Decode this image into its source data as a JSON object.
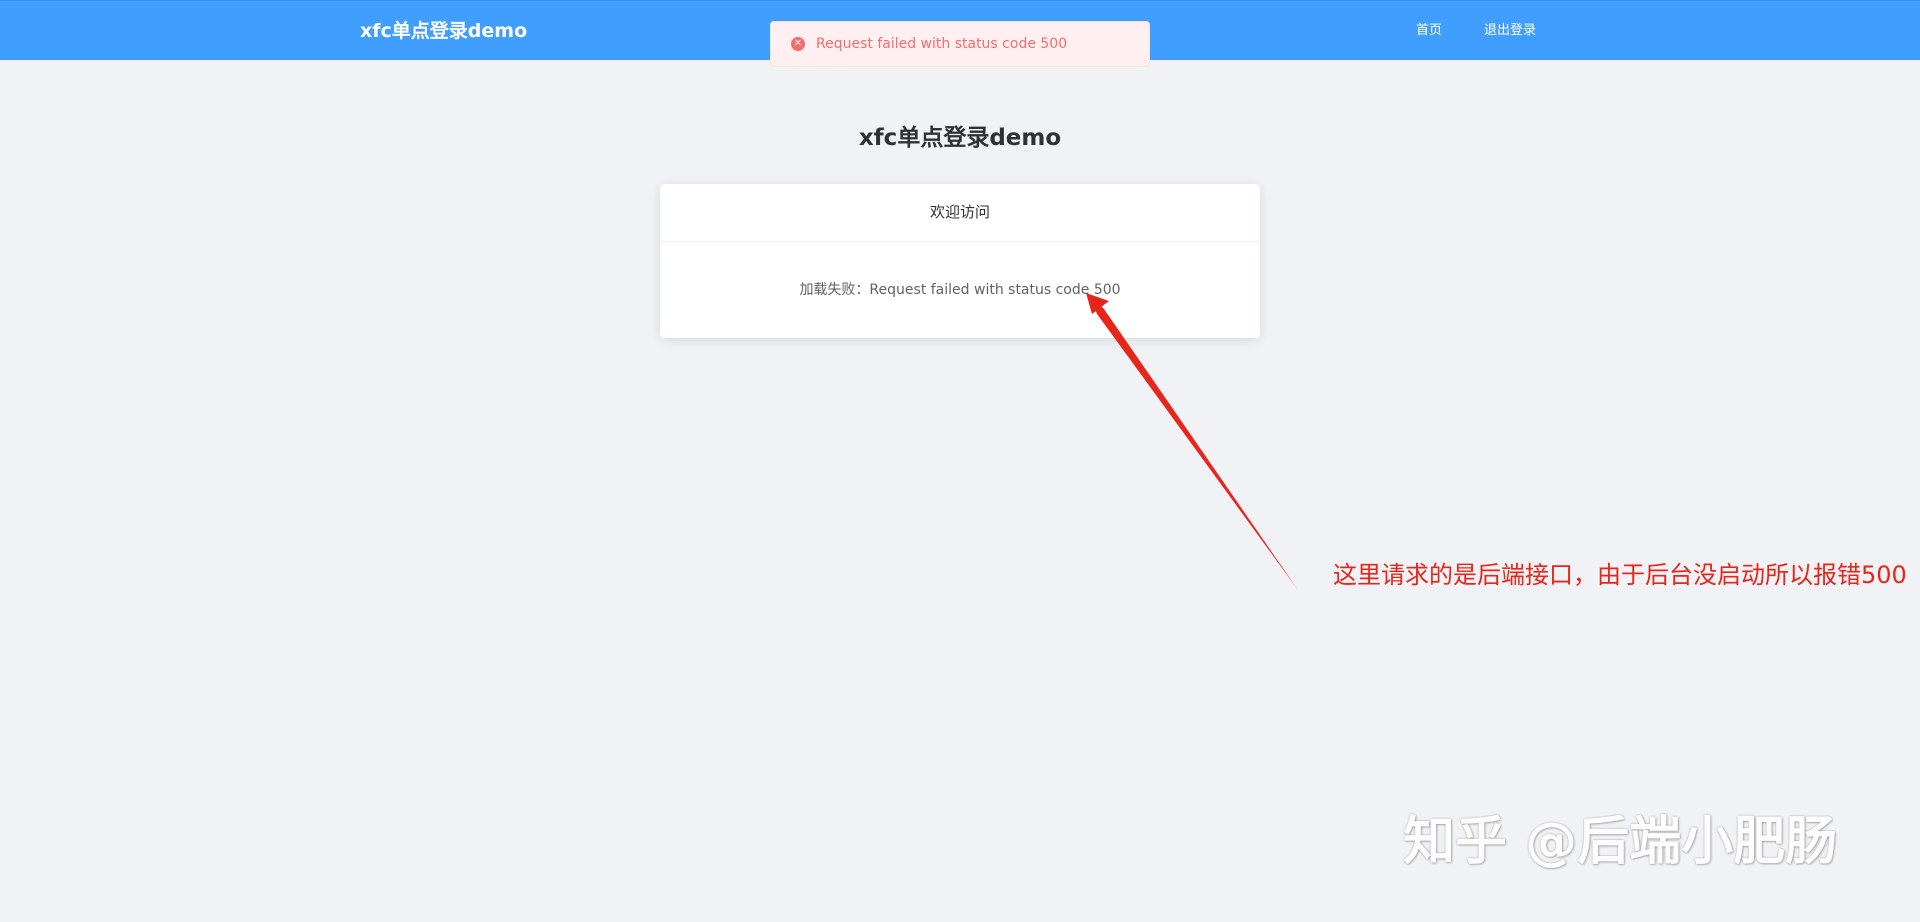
{
  "header": {
    "brand": "xfc单点登录demo",
    "nav": [
      {
        "label": "首页"
      },
      {
        "label": "退出登录"
      }
    ]
  },
  "toast": {
    "icon": "error-circle-icon",
    "message": "Request failed with status code 500"
  },
  "main": {
    "title": "xfc单点登录demo",
    "card": {
      "header": "欢迎访问",
      "body": "加载失败：Request failed with status code 500"
    }
  },
  "annotation": {
    "text": "这里请求的是后端接口，由于后台没启动所以报错500"
  },
  "watermark": {
    "text": "知乎 @后端小肥肠"
  },
  "colors": {
    "header_bg": "#409eff",
    "page_bg": "#f0f2f5",
    "error": "#f56c6c",
    "error_bg": "#fef0f0",
    "annotation": "#e8251a"
  }
}
